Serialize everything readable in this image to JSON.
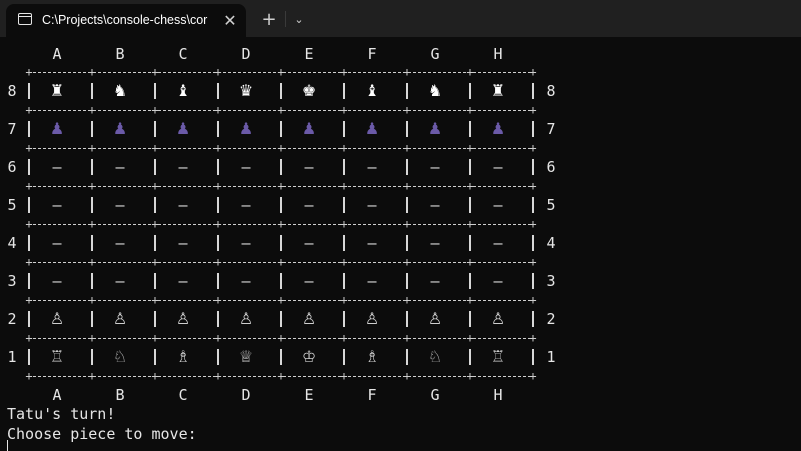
{
  "window": {
    "tab_title": "C:\\Projects\\console-chess\\cor",
    "close_glyph": "✕",
    "newtab_glyph": "+",
    "dropdown_glyph": "⌄",
    "icon": "terminal-icon"
  },
  "board": {
    "files": [
      "A",
      "B",
      "C",
      "D",
      "E",
      "F",
      "G",
      "H"
    ],
    "ranks": [
      "8",
      "7",
      "6",
      "5",
      "4",
      "3",
      "2",
      "1"
    ],
    "rows": [
      [
        "♜",
        "♞",
        "♝",
        "♛",
        "♚",
        "♝",
        "♞",
        "♜"
      ],
      [
        "♟",
        "♟",
        "♟",
        "♟",
        "♟",
        "♟",
        "♟",
        "♟"
      ],
      [
        "—",
        "—",
        "—",
        "—",
        "—",
        "—",
        "—",
        "—"
      ],
      [
        "—",
        "—",
        "—",
        "—",
        "—",
        "—",
        "—",
        "—"
      ],
      [
        "—",
        "—",
        "—",
        "—",
        "—",
        "—",
        "—",
        "—"
      ],
      [
        "—",
        "—",
        "—",
        "—",
        "—",
        "—",
        "—",
        "—"
      ],
      [
        "♙",
        "♙",
        "♙",
        "♙",
        "♙",
        "♙",
        "♙",
        "♙"
      ],
      [
        "♖",
        "♘",
        "♗",
        "♕",
        "♔",
        "♗",
        "♘",
        "♖"
      ]
    ],
    "colors": {
      "black_major": "#ffffff",
      "black_pawn": "#6b5aa8",
      "white_piece": "#cfcfcf"
    }
  },
  "console": {
    "line1": "Tatu's turn!",
    "line2": "Choose piece to move:"
  }
}
